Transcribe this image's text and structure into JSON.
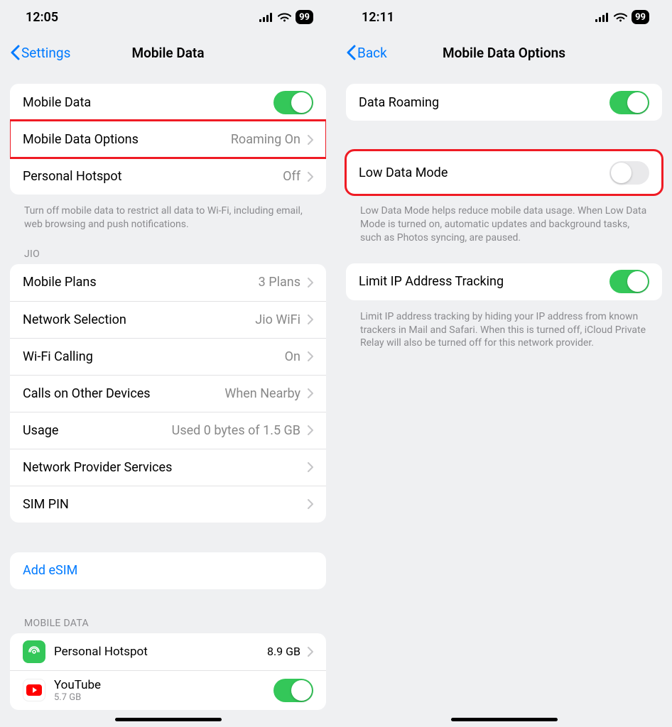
{
  "left": {
    "status_time": "12:05",
    "battery": "99",
    "back_label": "Settings",
    "title": "Mobile Data",
    "group1": {
      "mobile_data_label": "Mobile Data",
      "options_label": "Mobile Data Options",
      "options_detail": "Roaming On",
      "hotspot_label": "Personal Hotspot",
      "hotspot_detail": "Off"
    },
    "group1_footer": "Turn off mobile data to restrict all data to Wi-Fi, including email, web browsing and push notifications.",
    "jio_header": "JIO",
    "group2": {
      "plans_label": "Mobile Plans",
      "plans_detail": "3 Plans",
      "network_label": "Network Selection",
      "network_detail": "Jio WiFi",
      "wifi_calling_label": "Wi-Fi Calling",
      "wifi_calling_detail": "On",
      "calls_label": "Calls on Other Devices",
      "calls_detail": "When Nearby",
      "usage_label": "Usage",
      "usage_detail": "Used 0 bytes of 1.5 GB",
      "provider_label": "Network Provider Services",
      "simpin_label": "SIM PIN"
    },
    "add_esim_label": "Add eSIM",
    "mobile_data_header": "MOBILE DATA",
    "apps": {
      "hotspot_name": "Personal Hotspot",
      "hotspot_usage": "8.9 GB",
      "youtube_name": "YouTube",
      "youtube_usage": "5.7 GB"
    }
  },
  "right": {
    "status_time": "12:11",
    "battery": "99",
    "back_label": "Back",
    "title": "Mobile Data Options",
    "roaming_label": "Data Roaming",
    "low_data_label": "Low Data Mode",
    "low_data_footer": "Low Data Mode helps reduce mobile data usage. When Low Data Mode is turned on, automatic updates and background tasks, such as Photos syncing, are paused.",
    "limit_ip_label": "Limit IP Address Tracking",
    "limit_ip_footer": "Limit IP address tracking by hiding your IP address from known trackers in Mail and Safari. When this is turned off, iCloud Private Relay will also be turned off for this network provider."
  }
}
